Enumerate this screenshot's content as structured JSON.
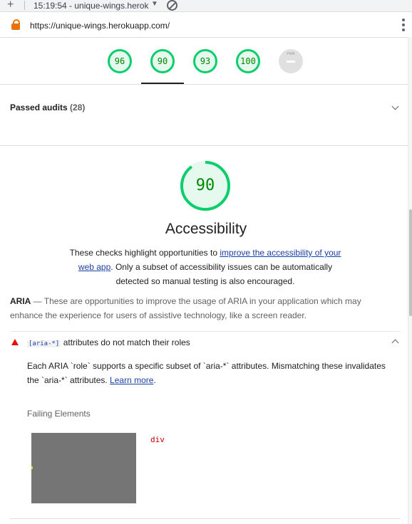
{
  "browser": {
    "new_tab_glyph": "+",
    "tab_title": "15:19:54 - unique-wings.herok",
    "tab_dropdown_glyph": "▼",
    "url": "https://unique-wings.herokuapp.com/",
    "icons": [
      "lock-icon",
      "block-icon",
      "menu-dots-icon"
    ]
  },
  "score_nav": {
    "gauges": [
      {
        "score": "96"
      },
      {
        "score": "90"
      },
      {
        "score": "93"
      },
      {
        "score": "100"
      }
    ],
    "pwa_label": "PWA",
    "colors": {
      "pass": "#0cce6b",
      "pass_text": "#008800",
      "na": "#e0e0e0"
    }
  },
  "passed_audits": {
    "label": "Passed audits",
    "count": "(28)"
  },
  "category": {
    "score": "90",
    "score_fraction": 0.9,
    "title": "Accessibility",
    "desc_before": "These checks highlight opportunities to ",
    "desc_link": "improve the accessibility of your web app",
    "desc_after": ". Only a subset of accessibility issues can be automatically detected so manual testing is also encouraged."
  },
  "group": {
    "title": "ARIA",
    "dash": " — ",
    "description": "These are opportunities to improve the usage of ARIA in your application which may enhance the experience for users of assistive technology, like a screen reader."
  },
  "audit": {
    "title_code": "[aria-*]",
    "title_rest": " attributes do not match their roles",
    "desc_text": "Each ARIA `role` supports a specific subset of `aria-*` attributes. Mismatching these invalidates the `aria-*` attributes. ",
    "desc_link": "Learn more",
    "desc_end": ".",
    "failing_label": "Failing Elements",
    "node": "div",
    "fail_color": "#eb0f00"
  }
}
